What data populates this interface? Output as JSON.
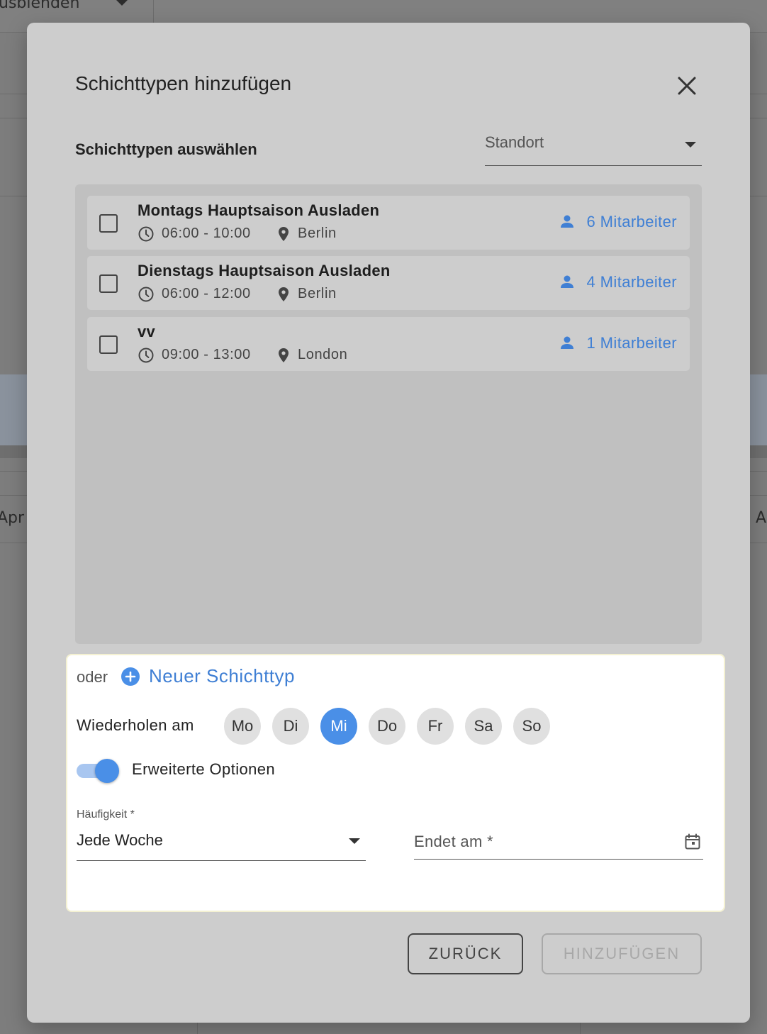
{
  "background": {
    "top_text": "usblenden",
    "month_left": "Apr",
    "month_right": "A"
  },
  "dialog": {
    "title": "Schichttypen hinzufügen",
    "section_label": "Schichttypen auswählen",
    "standort_label": "Standort",
    "shifts": [
      {
        "name": "Montags Hauptsaison Ausladen",
        "time": "06:00 - 10:00",
        "location": "Berlin",
        "employees": "6 Mitarbeiter"
      },
      {
        "name": "Dienstags Hauptsaison Ausladen",
        "time": "06:00 - 12:00",
        "location": "Berlin",
        "employees": "4 Mitarbeiter"
      },
      {
        "name": "vv",
        "time": "09:00 - 13:00",
        "location": "London",
        "employees": "1 Mitarbeiter"
      }
    ],
    "or_label": "oder",
    "new_shift_link": "Neuer Schichttyp",
    "repeat_label": "Wiederholen am",
    "days": [
      {
        "label": "Mo",
        "active": false
      },
      {
        "label": "Di",
        "active": false
      },
      {
        "label": "Mi",
        "active": true
      },
      {
        "label": "Do",
        "active": false
      },
      {
        "label": "Fr",
        "active": false
      },
      {
        "label": "Sa",
        "active": false
      },
      {
        "label": "So",
        "active": false
      }
    ],
    "advanced_toggle": {
      "label": "Erweiterte Optionen",
      "on": true
    },
    "frequency": {
      "label": "Häufigkeit *",
      "value": "Jede Woche"
    },
    "end_date": {
      "placeholder": "Endet am *"
    },
    "back_button": "ZURÜCK",
    "add_button": "HINZUFÜGEN",
    "colors": {
      "accent": "#4a8fe7",
      "link": "#3f7fd4",
      "disabled": "#a8a8a8"
    }
  }
}
